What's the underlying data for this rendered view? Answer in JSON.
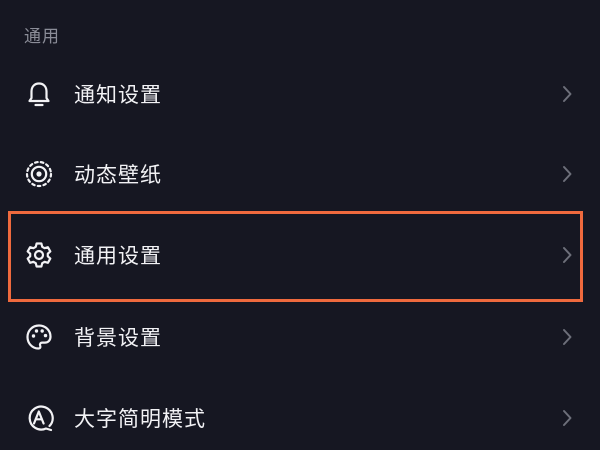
{
  "section": {
    "title": "通用"
  },
  "menu": {
    "items": [
      {
        "id": "notification",
        "label": "通知设置",
        "icon": "bell-icon"
      },
      {
        "id": "live-wallpaper",
        "label": "动态壁纸",
        "icon": "live-wallpaper-icon"
      },
      {
        "id": "general",
        "label": "通用设置",
        "icon": "gear-icon"
      },
      {
        "id": "background",
        "label": "背景设置",
        "icon": "palette-icon"
      },
      {
        "id": "large-text",
        "label": "大字简明模式",
        "icon": "large-text-icon"
      }
    ]
  },
  "colors": {
    "background": "#161722",
    "text": "#f2f2f5",
    "section_title": "#8b8d98",
    "chevron": "#6d6f7a",
    "highlight": "#ef6a3e"
  }
}
